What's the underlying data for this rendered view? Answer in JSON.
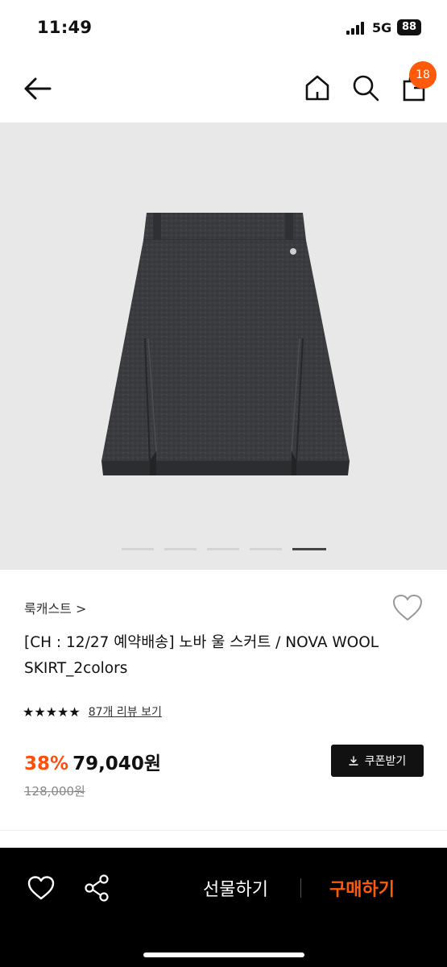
{
  "status": {
    "time": "11:49",
    "network": "5G",
    "battery": "88"
  },
  "nav": {
    "back_icon": "arrow-left-icon",
    "home_icon": "home-icon",
    "search_icon": "search-icon",
    "bag_icon": "shopping-bag-icon",
    "cart_count": "18"
  },
  "gallery": {
    "image_desc": "charcoal wool pleated mini skirt",
    "current_slide": 5,
    "slide_count": 5
  },
  "product": {
    "brand": "룩캐스트 >",
    "title": "[CH : 12/27 예약배송] 노바 울 스커트 / NOVA WOOL SKIRT_2colors",
    "stars": "★★★★★",
    "review_link": "87개 리뷰 보기",
    "discount": "38%",
    "price": "79,040원",
    "original_price": "128,000원",
    "coupon_label": "쿠폰받기"
  },
  "bottom_bar": {
    "gift_label": "선물하기",
    "buy_label": "구매하기"
  },
  "colors": {
    "accent": "#ff5a0a",
    "hero_bg": "#e8e8e8",
    "skirt": "#3a3b3e"
  }
}
